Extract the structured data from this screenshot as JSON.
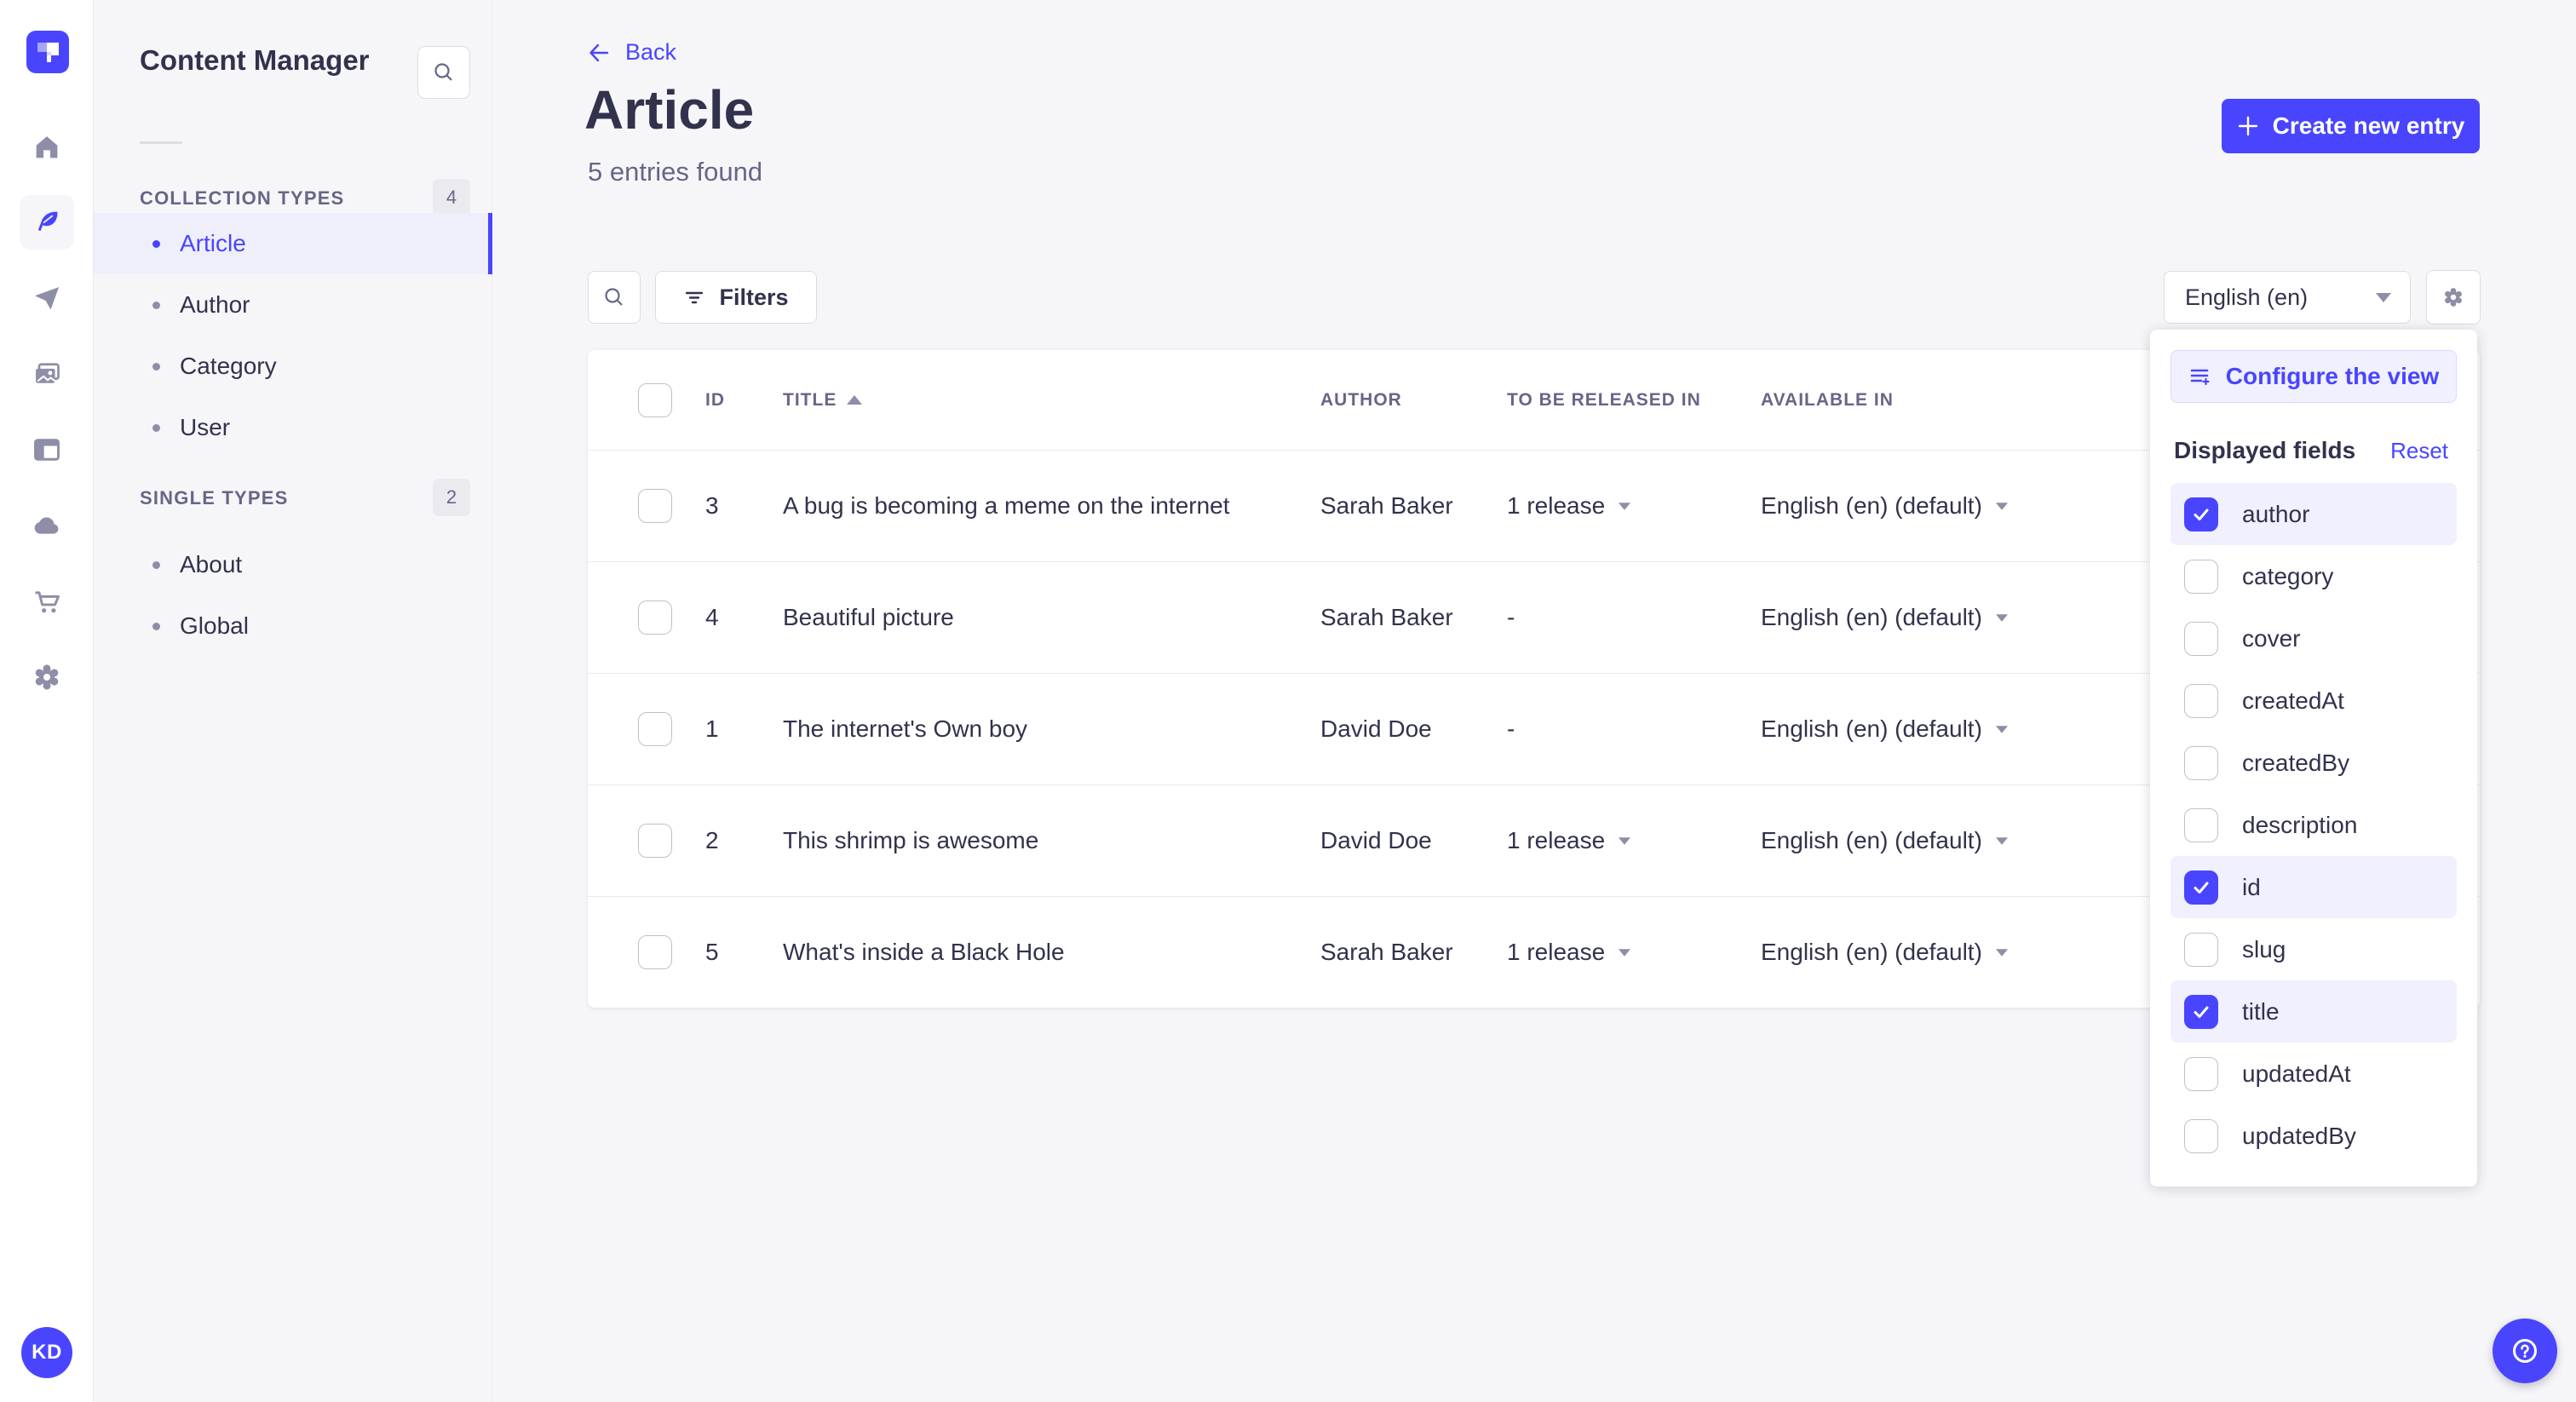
{
  "colors": {
    "primary": "#4945FF",
    "primary_light": "#F0F0FF",
    "text_dark": "#32324D",
    "text_muted": "#666687"
  },
  "rail": {
    "items": [
      "home",
      "content-manager",
      "releases",
      "media-library",
      "content-type-builder",
      "cloud",
      "marketplace",
      "settings"
    ],
    "active": "content-manager",
    "avatar_initials": "KD"
  },
  "sidebar": {
    "title": "Content Manager",
    "collection_types": {
      "label": "COLLECTION TYPES",
      "count": "4",
      "items": [
        "Article",
        "Author",
        "Category",
        "User"
      ],
      "active": "Article"
    },
    "single_types": {
      "label": "SINGLE TYPES",
      "count": "2",
      "items": [
        "About",
        "Global"
      ]
    }
  },
  "header": {
    "back_label": "Back",
    "title": "Article",
    "subtitle": "5 entries found",
    "create_button_label": "Create new entry"
  },
  "toolbar": {
    "filters_label": "Filters",
    "locale_value": "English (en)"
  },
  "table": {
    "columns": [
      "ID",
      "TITLE",
      "AUTHOR",
      "TO BE RELEASED IN",
      "AVAILABLE IN"
    ],
    "sorted_column": "TITLE",
    "sort_direction": "asc",
    "rows": [
      {
        "id": "3",
        "title": "A bug is becoming a meme on the internet",
        "author": "Sarah Baker",
        "to_be_released_in": "1 release",
        "has_release": true,
        "available_in": "English (en) (default)"
      },
      {
        "id": "4",
        "title": "Beautiful picture",
        "author": "Sarah Baker",
        "to_be_released_in": "-",
        "has_release": false,
        "available_in": "English (en) (default)"
      },
      {
        "id": "1",
        "title": "The internet's Own boy",
        "author": "David Doe",
        "to_be_released_in": "-",
        "has_release": false,
        "available_in": "English (en) (default)"
      },
      {
        "id": "2",
        "title": "This shrimp is awesome",
        "author": "David Doe",
        "to_be_released_in": "1 release",
        "has_release": true,
        "available_in": "English (en) (default)"
      },
      {
        "id": "5",
        "title": "What's inside a Black Hole",
        "author": "Sarah Baker",
        "to_be_released_in": "1 release",
        "has_release": true,
        "available_in": "English (en) (default)"
      }
    ]
  },
  "configure_panel": {
    "button_label": "Configure the view",
    "section_title": "Displayed fields",
    "reset_label": "Reset",
    "fields": [
      {
        "label": "author",
        "checked": true
      },
      {
        "label": "category",
        "checked": false
      },
      {
        "label": "cover",
        "checked": false
      },
      {
        "label": "createdAt",
        "checked": false
      },
      {
        "label": "createdBy",
        "checked": false
      },
      {
        "label": "description",
        "checked": false
      },
      {
        "label": "id",
        "checked": true
      },
      {
        "label": "slug",
        "checked": false
      },
      {
        "label": "title",
        "checked": true
      },
      {
        "label": "updatedAt",
        "checked": false
      },
      {
        "label": "updatedBy",
        "checked": false
      }
    ]
  }
}
